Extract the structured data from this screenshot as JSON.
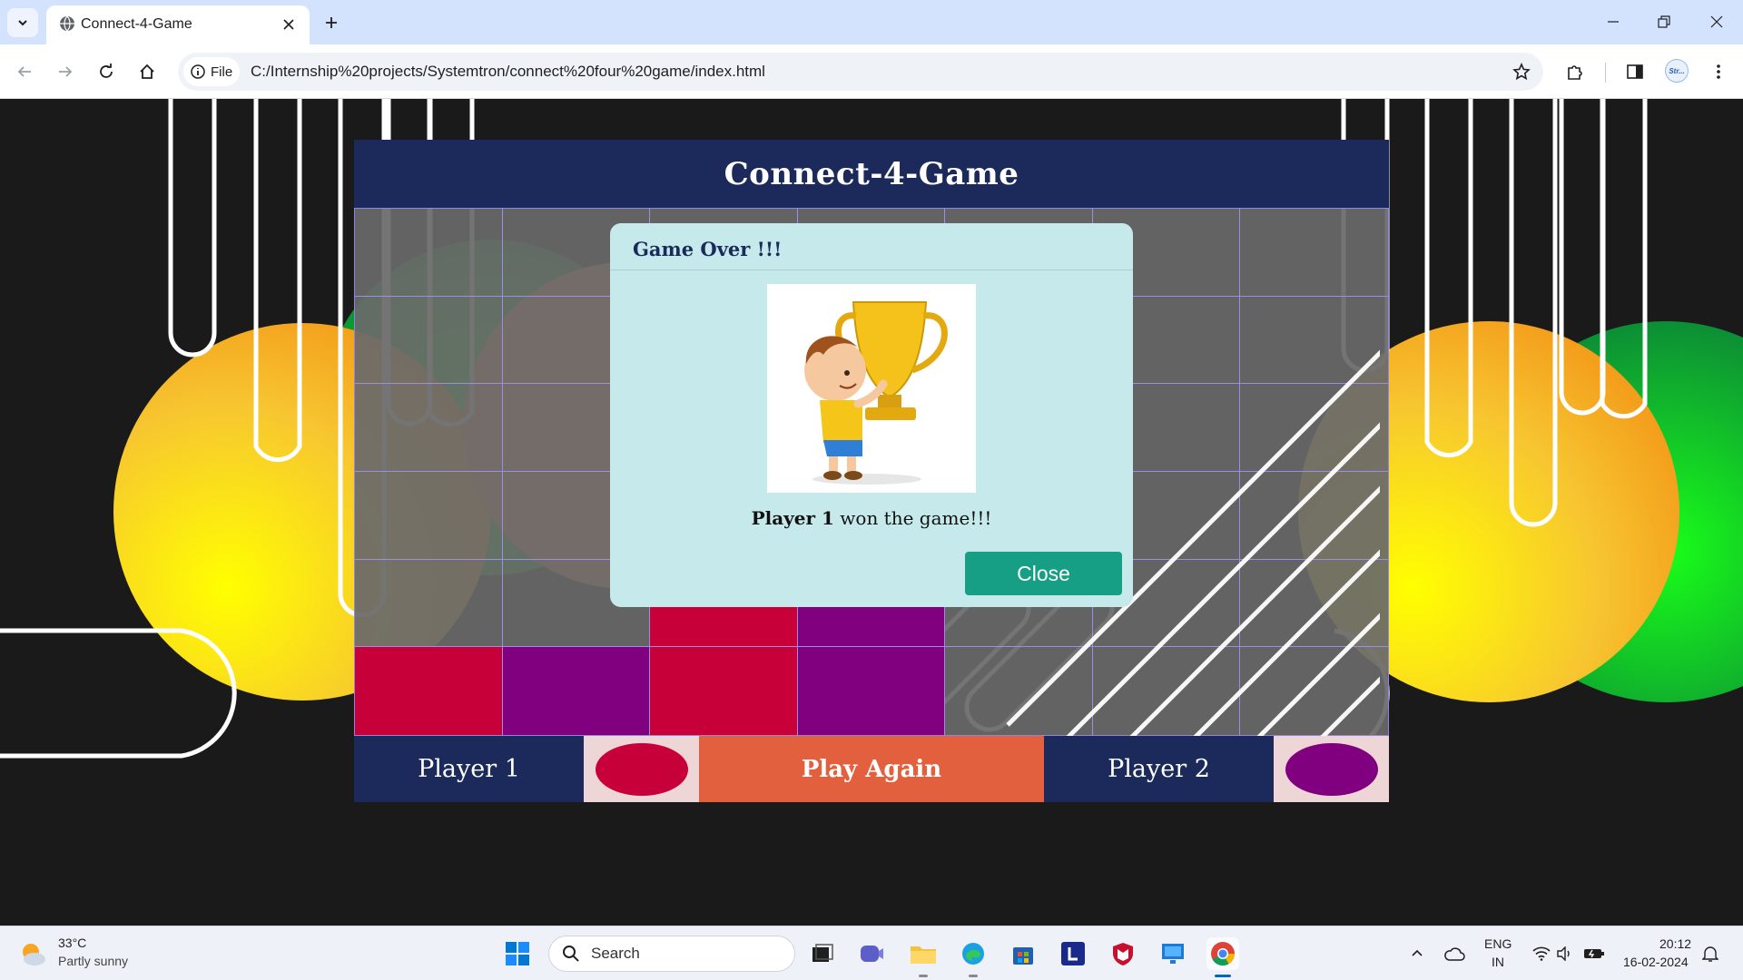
{
  "browser": {
    "tab_title": "Connect-4-Game",
    "site_chip": "File",
    "url": "C:/Internship%20projects/Systemtron/connect%20four%20game/index.html",
    "profile_badge": "Str..."
  },
  "game": {
    "title": "Connect-4-Game",
    "board": {
      "rows": [
        [
          "empty",
          "empty",
          "empty",
          "empty",
          "empty",
          "empty",
          "empty"
        ],
        [
          "empty",
          "empty",
          "empty",
          "empty",
          "empty",
          "empty",
          "empty"
        ],
        [
          "empty",
          "empty",
          "empty",
          "empty",
          "empty",
          "empty",
          "empty"
        ],
        [
          "empty",
          "empty",
          "empty",
          "empty",
          "empty",
          "empty",
          "empty"
        ],
        [
          "empty",
          "empty",
          "red",
          "purple",
          "empty",
          "empty",
          "empty"
        ],
        [
          "red",
          "purple",
          "red",
          "purple",
          "empty",
          "empty",
          "empty"
        ]
      ]
    },
    "footer": {
      "player1_label": "Player 1",
      "player1_color": "#c80039",
      "play_again_label": "Play Again",
      "player2_label": "Player 2",
      "player2_color": "#800080"
    }
  },
  "modal": {
    "title": "Game Over !!!",
    "message_bold": "Player 1",
    "message_rest": " won the game!!!",
    "close_label": "Close"
  },
  "taskbar": {
    "weather_temp": "33°C",
    "weather_desc": "Partly sunny",
    "search_placeholder": "Search",
    "lang_top": "ENG",
    "lang_bottom": "IN",
    "time": "20:12",
    "date": "16-02-2024"
  }
}
